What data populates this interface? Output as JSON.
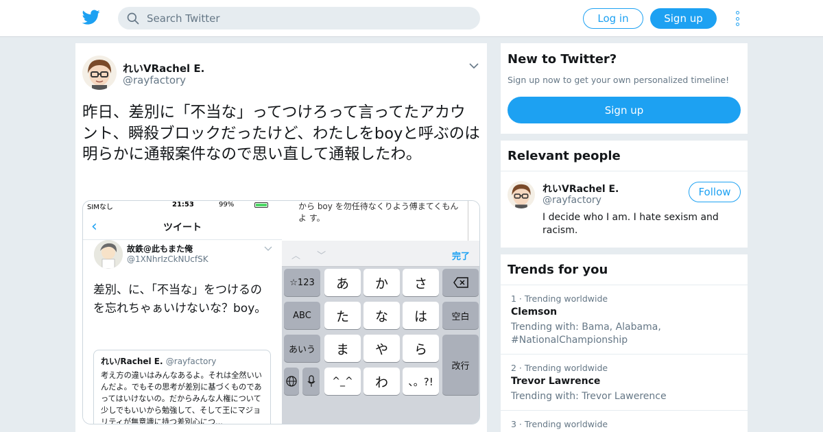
{
  "header": {
    "search_placeholder": "Search Twitter",
    "login_label": "Log in",
    "signup_label": "Sign up",
    "brand_color": "#1da1f2"
  },
  "tweet": {
    "author_name": "れいVRachel E.",
    "author_handle": "@rayfactory",
    "text": "昨日、差別に「不当な」ってつけろって言ってたアカウント、瞬殺ブロックだったけど、わたしをboyと呼ぶのは明らかに通報案件なので思い直して通報したわ。",
    "media": {
      "status_carrier": "SIMなし",
      "status_time": "21:53",
      "status_battery": "99%",
      "nav_back": "‹",
      "nav_title": "ツイート",
      "inner_author": "故鉄@此もまた俺",
      "inner_handle": "@1XNhrIzCkNUcfSK",
      "inner_text": "差別、に、「不当な」をつけるのを忘れちゃぁいけないな？boy。",
      "quote_name": "れい/Rachel E.",
      "quote_handle": "@rayfactory",
      "quote_text": "考え方の違いはみんなあるよ。それは全然いいんだよ。でもその思考が差別に基づくものであってはいけないの。だからみんな人権について少しでもいいから勉強して、そして王にマジョリティが無意識に持つ差別心につ...",
      "draft_text": "から boy を勿任待なくりよう傅まてくもんよ す。",
      "keyboard_done": "完了",
      "keyboard_arrows": "︿ ﹀",
      "keys": {
        "k123": "☆123",
        "abc": "ABC",
        "aiu": "あいう",
        "a": "あ",
        "ka": "か",
        "sa": "さ",
        "ta": "た",
        "na": "な",
        "ha": "は",
        "ma": "ま",
        "ya": "や",
        "ra": "ら",
        "emo": "^_^",
        "wa": "わ",
        "punct": "、。?!",
        "space": "空白",
        "enter": "改行"
      }
    }
  },
  "sidebar": {
    "new_title": "New to Twitter?",
    "new_sub": "Sign up now to get your own personalized timeline!",
    "new_signup": "Sign up",
    "people_title": "Relevant people",
    "person": {
      "name": "れいVRachel E.",
      "handle": "@rayfactory",
      "follow_label": "Follow",
      "bio": "I decide who I am. I hate sexism and racism."
    },
    "trends_title": "Trends for you",
    "trends": [
      {
        "meta": "1 · Trending worldwide",
        "name": "Clemson",
        "with": "Trending with: Bama, Alabama, #NationalChampionship"
      },
      {
        "meta": "2 · Trending worldwide",
        "name": "Trevor Lawrence",
        "with": "Trending with: Trevor Lawerence"
      },
      {
        "meta": "3 · Trending worldwide",
        "name": "",
        "with": ""
      }
    ]
  }
}
